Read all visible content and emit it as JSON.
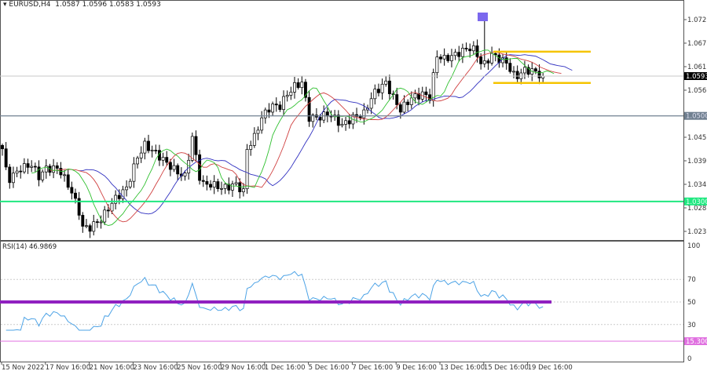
{
  "header": {
    "symbol": "EURUSD,H4",
    "ohlc": "1.0587 1.0596 1.0583 1.0593"
  },
  "rsi": {
    "label": "RSI(14) 46.9869",
    "levels": [
      "100",
      "70",
      "50",
      "30",
      "0"
    ],
    "marker": "15.3000",
    "period": 14
  },
  "price_axis": {
    "labels": [
      "1.0725",
      "1.0670",
      "1.0615",
      "1.0560",
      "1.0450",
      "1.0395",
      "1.0340",
      "1.0285",
      "1.0230"
    ],
    "current": "1.0593",
    "level_1": "1.0500",
    "level_2": "1.0300"
  },
  "time_axis": [
    "15 Nov 2022",
    "17 Nov 16:00",
    "21 Nov 16:00",
    "23 Nov 16:00",
    "25 Nov 16:00",
    "29 Nov 16:00",
    "1 Dec 16:00",
    "5 Dec 16:00",
    "7 Dec 16:00",
    "9 Dec 16:00",
    "13 Dec 16:00",
    "15 Dec 16:00",
    "19 Dec 16:00"
  ],
  "colors": {
    "support": "#20e880",
    "resistance": "#708090",
    "range": "#f5c400",
    "rsi_line": "#4da3e6",
    "rsi_mid": "#9020c0",
    "rsi_low": "#e070e0",
    "jaw": "#3030c0",
    "teeth": "#d04040",
    "lips": "#30c030"
  },
  "chart_data": {
    "type": "candlestick",
    "price_range": [
      1.0205,
      1.076
    ],
    "range_box": [
      1.0577,
      1.065
    ],
    "close_path": [
      [
        0,
        1.0423
      ],
      [
        1.5,
        1.0349
      ],
      [
        5,
        1.0377
      ],
      [
        8,
        1.0386
      ],
      [
        10,
        1.0358
      ],
      [
        12,
        1.0377
      ],
      [
        15.5,
        1.0377
      ],
      [
        19,
        1.0322
      ],
      [
        21,
        1.0276
      ],
      [
        22,
        1.0239
      ],
      [
        24,
        1.0239
      ],
      [
        27,
        1.0258
      ],
      [
        30.5,
        1.0303
      ],
      [
        34,
        1.0331
      ],
      [
        37,
        1.0404
      ],
      [
        39,
        1.0432
      ],
      [
        42,
        1.0413
      ],
      [
        45.5,
        1.0386
      ],
      [
        48,
        1.0368
      ],
      [
        50,
        1.0358
      ],
      [
        52,
        1.045
      ],
      [
        54,
        1.0358
      ],
      [
        55,
        1.034
      ],
      [
        57,
        1.034
      ],
      [
        60.5,
        1.0331
      ],
      [
        64,
        1.034
      ],
      [
        66,
        1.0322
      ],
      [
        67,
        1.0423
      ],
      [
        69,
        1.045
      ],
      [
        71,
        1.0496
      ],
      [
        73.5,
        1.0523
      ],
      [
        76,
        1.0523
      ],
      [
        78,
        1.0551
      ],
      [
        80,
        1.0569
      ],
      [
        82,
        1.0578
      ],
      [
        84,
        1.0496
      ],
      [
        86.5,
        1.0496
      ],
      [
        89.5,
        1.0505
      ],
      [
        93,
        1.0478
      ],
      [
        96,
        1.0496
      ],
      [
        99,
        1.0505
      ],
      [
        101.5,
        1.0551
      ],
      [
        105,
        1.0578
      ],
      [
        107,
        1.0542
      ],
      [
        109,
        1.0514
      ],
      [
        112,
        1.0542
      ],
      [
        115,
        1.0551
      ],
      [
        117.5,
        1.0542
      ],
      [
        118.5,
        1.0643
      ],
      [
        121,
        1.0633
      ],
      [
        124,
        1.0643
      ],
      [
        126,
        1.0652
      ],
      [
        128.5,
        1.0661
      ],
      [
        130,
        1.0643
      ],
      [
        131.5,
        1.0615
      ],
      [
        134,
        1.0643
      ],
      [
        136,
        1.0633
      ],
      [
        138,
        1.0624
      ],
      [
        140.5,
        1.0588
      ],
      [
        142.5,
        1.0606
      ],
      [
        145,
        1.0606
      ],
      [
        147,
        1.0597
      ],
      [
        148,
        1.0593
      ]
    ]
  }
}
